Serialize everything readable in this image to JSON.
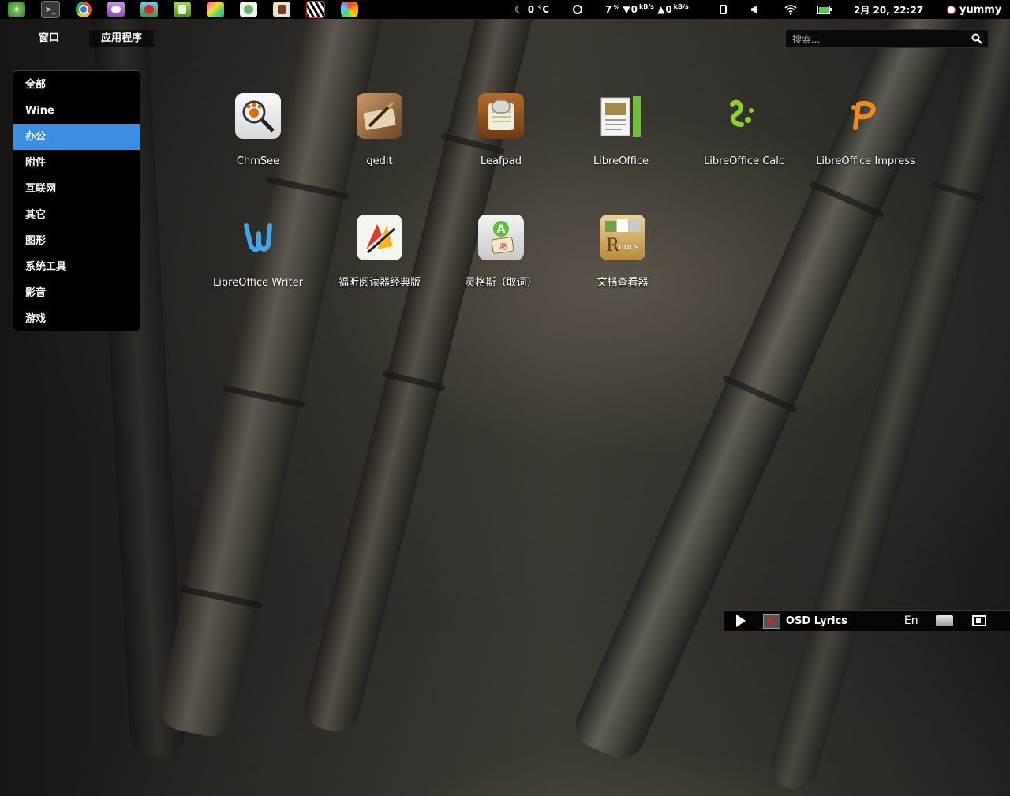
{
  "launcher": {
    "icons": [
      "app-launcher-icon",
      "terminal-icon",
      "chrome-icon",
      "messenger-icon",
      "angry-birds-icon",
      "file-manager-icon",
      "color-picker-icon",
      "reader-icon",
      "media-player-icon",
      "piano-icon",
      "palette-icon"
    ]
  },
  "tray": {
    "weather": "0 °C",
    "cpu": "7",
    "cpu_unit": "%",
    "net_down": "0",
    "net_down_unit": "kB/s",
    "net_up": "0",
    "net_up_unit": "kB/s",
    "datetime": "2月 20, 22:27",
    "user": "yummy"
  },
  "topbar": {
    "window_menu": "窗口",
    "apps_menu": "应用程序"
  },
  "search": {
    "placeholder": "搜索..."
  },
  "categories": [
    {
      "label": "全部"
    },
    {
      "label": "Wine"
    },
    {
      "label": "办公"
    },
    {
      "label": "附件"
    },
    {
      "label": "互联网"
    },
    {
      "label": "其它"
    },
    {
      "label": "图形"
    },
    {
      "label": "系统工具"
    },
    {
      "label": "影音"
    },
    {
      "label": "游戏"
    }
  ],
  "active_category": "办公",
  "apps": [
    {
      "label": "ChmSee",
      "icon": "chmsee-icon"
    },
    {
      "label": "gedit",
      "icon": "gedit-icon"
    },
    {
      "label": "Leafpad",
      "icon": "leafpad-icon"
    },
    {
      "label": "LibreOffice",
      "icon": "libreoffice-icon"
    },
    {
      "label": "LibreOffice Calc",
      "icon": "libreoffice-calc-icon"
    },
    {
      "label": "LibreOffice Impress",
      "icon": "libreoffice-impress-icon"
    },
    {
      "label": "LibreOffice Writer",
      "icon": "libreoffice-writer-icon"
    },
    {
      "label": "福昕阅读器经典版",
      "icon": "foxit-reader-icon"
    },
    {
      "label": "灵格斯（取词）",
      "icon": "lingoes-icon"
    },
    {
      "label": "文档查看器",
      "icon": "document-viewer-icon"
    }
  ],
  "bottom_panel": {
    "lyrics": "OSD Lyrics",
    "input_method": "En"
  },
  "colors": {
    "accent": "#3b8fe3",
    "panel": "#000000"
  }
}
